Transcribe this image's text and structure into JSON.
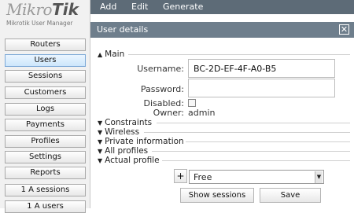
{
  "brand": {
    "logo_main": "Mikro",
    "logo_bold": "Tik",
    "subtitle": "Mikrotik User Manager"
  },
  "sidebar": {
    "items": [
      {
        "label": "Routers",
        "active": false
      },
      {
        "label": "Users",
        "active": true
      },
      {
        "label": "Sessions",
        "active": false
      },
      {
        "label": "Customers",
        "active": false
      },
      {
        "label": "Logs",
        "active": false
      },
      {
        "label": "Payments",
        "active": false
      },
      {
        "label": "Profiles",
        "active": false
      },
      {
        "label": "Settings",
        "active": false
      },
      {
        "label": "Reports",
        "active": false
      },
      {
        "label": "1 A sessions",
        "active": false
      },
      {
        "label": "1 A users",
        "active": false
      }
    ]
  },
  "menu": {
    "items": [
      "Add",
      "Edit",
      "Generate"
    ]
  },
  "panel": {
    "title": "User details",
    "close_icon": "close-icon",
    "sections": {
      "main": "Main",
      "constraints": "Constraints",
      "wireless": "Wireless",
      "private_information": "Private information",
      "all_profiles": "All profiles",
      "actual_profile": "Actual profile"
    },
    "fields": {
      "username_label": "Username:",
      "username_value": "BC-2D-EF-4F-A0-B5",
      "password_label": "Password:",
      "password_value": "",
      "disabled_label": "Disabled:",
      "disabled_checked": false,
      "owner_label": "Owner:",
      "owner_value": "admin"
    },
    "profile": {
      "add_label": "+",
      "selected": "Free"
    },
    "buttons": {
      "show_sessions": "Show sessions",
      "save": "Save"
    }
  },
  "colors": {
    "menu_bar": "#5d6b77",
    "panel_header": "#6e7e8c",
    "active_nav": "#cde6fb"
  }
}
